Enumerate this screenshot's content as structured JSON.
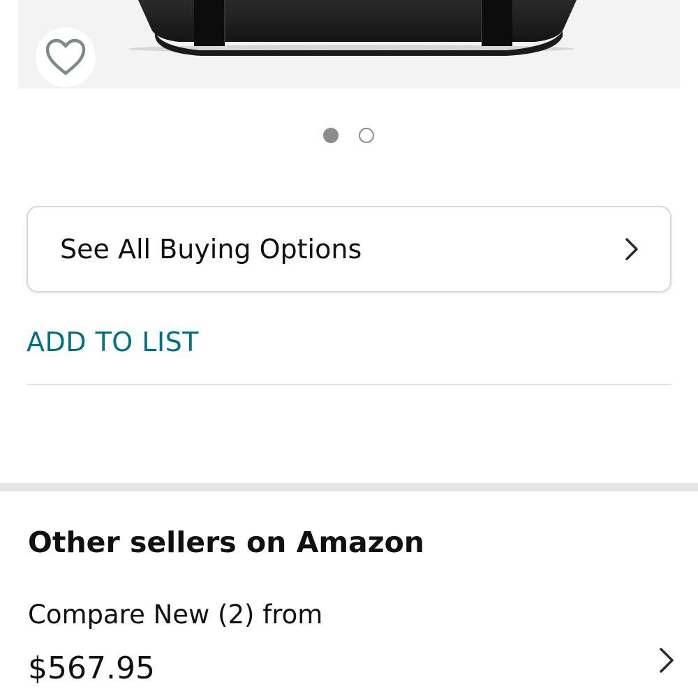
{
  "product_image": {
    "wishlist_icon": "heart-outline-icon"
  },
  "carousel": {
    "total": 2,
    "active_index": 0
  },
  "buying_options": {
    "label": "See All Buying Options",
    "icon": "chevron-right-icon"
  },
  "add_to_list": {
    "label": "ADD TO LIST"
  },
  "other_sellers": {
    "title": "Other sellers on Amazon",
    "compare_text": "Compare New (2) from",
    "price": "$567.95",
    "icon": "chevron-right-icon"
  },
  "colors": {
    "link": "#007185",
    "text": "#0f1111",
    "border": "#d5d9d9",
    "dot": "#8c8c8c",
    "separator": "#e3e6e6"
  }
}
